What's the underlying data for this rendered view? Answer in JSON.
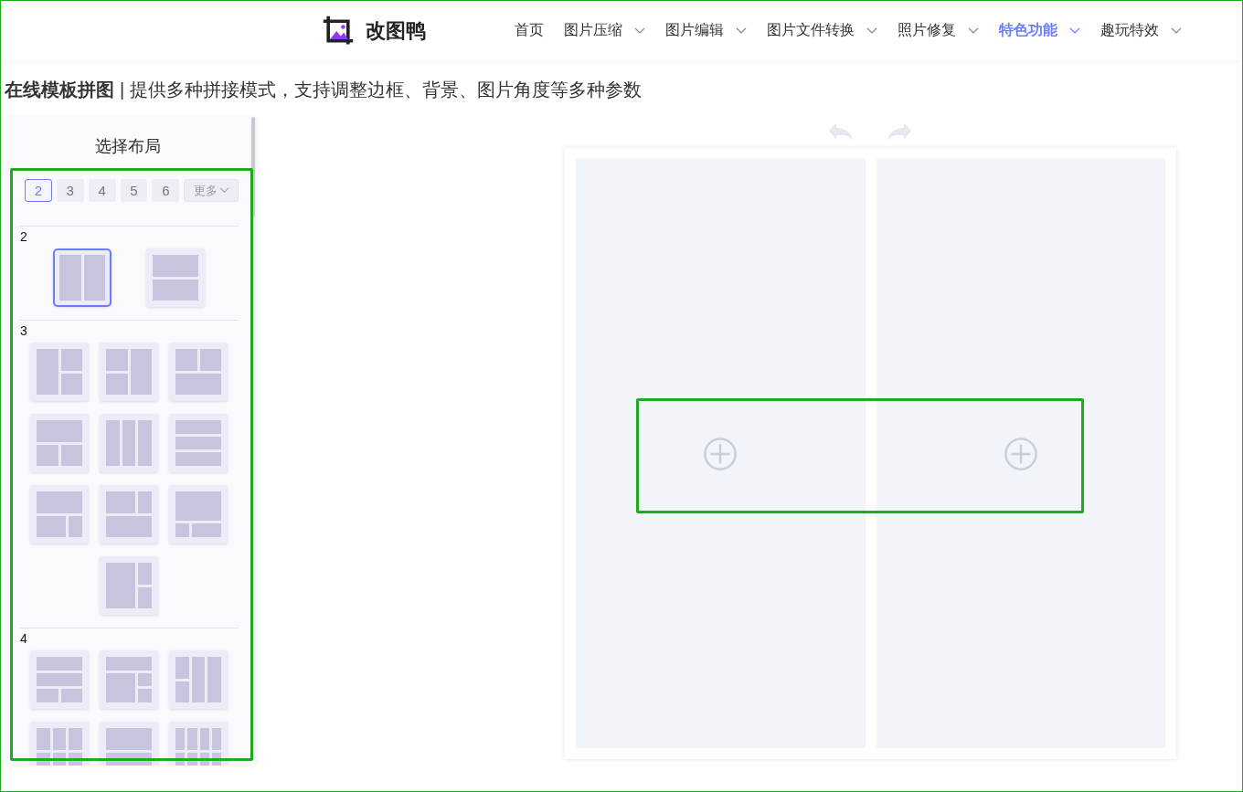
{
  "header": {
    "logo_text": "改图鸭",
    "nav": [
      {
        "label": "首页",
        "dropdown": false,
        "selected": false
      },
      {
        "label": "图片压缩",
        "dropdown": true,
        "selected": false
      },
      {
        "label": "图片编辑",
        "dropdown": true,
        "selected": false
      },
      {
        "label": "图片文件转换",
        "dropdown": true,
        "selected": false
      },
      {
        "label": "照片修复",
        "dropdown": true,
        "selected": false
      },
      {
        "label": "特色功能",
        "dropdown": true,
        "selected": true
      },
      {
        "label": "趣玩特效",
        "dropdown": true,
        "selected": false
      }
    ]
  },
  "intro": {
    "title": "在线模板拼图",
    "separator": "|",
    "description": "提供多种拼接模式，支持调整边框、背景、图片角度等多种参数"
  },
  "layout_panel": {
    "title": "选择布局",
    "count_tabs": [
      {
        "label": "2",
        "selected": true
      },
      {
        "label": "3",
        "selected": false
      },
      {
        "label": "4",
        "selected": false
      },
      {
        "label": "5",
        "selected": false
      },
      {
        "label": "6",
        "selected": false
      }
    ],
    "more_button": {
      "label": "更多",
      "disabled": true
    },
    "sections": [
      {
        "label": "2",
        "layouts": [
          {
            "kind": "columns",
            "selected": true
          },
          {
            "kind": "rows",
            "selected": false
          }
        ]
      },
      {
        "label": "3",
        "layouts": [
          {
            "kind": "leftmain",
            "selected": false
          },
          {
            "kind": "rightmain",
            "selected": false
          },
          {
            "kind": "topsplit",
            "selected": false
          },
          {
            "kind": "bottomsplit",
            "selected": false
          },
          {
            "kind": "columns",
            "selected": false
          },
          {
            "kind": "rows",
            "selected": false
          },
          {
            "kind": "bannerbottomwide",
            "selected": false
          },
          {
            "kind": "topwidebanner",
            "selected": false
          },
          {
            "kind": "bigtop",
            "selected": false
          },
          {
            "kind": "bigleft",
            "selected": false
          }
        ]
      },
      {
        "label": "4",
        "layouts": [
          {
            "kind": "threebands",
            "selected": false
          },
          {
            "kind": "bannerstack",
            "selected": false
          },
          {
            "kind": "splitcolumns",
            "selected": false
          },
          {
            "kind": "grid",
            "selected": false
          },
          {
            "kind": "bannerrows",
            "selected": false
          },
          {
            "kind": "fourcolumns",
            "selected": false
          }
        ]
      }
    ]
  },
  "canvas": {
    "cells": [
      {
        "kind": "empty"
      },
      {
        "kind": "empty"
      }
    ]
  }
}
